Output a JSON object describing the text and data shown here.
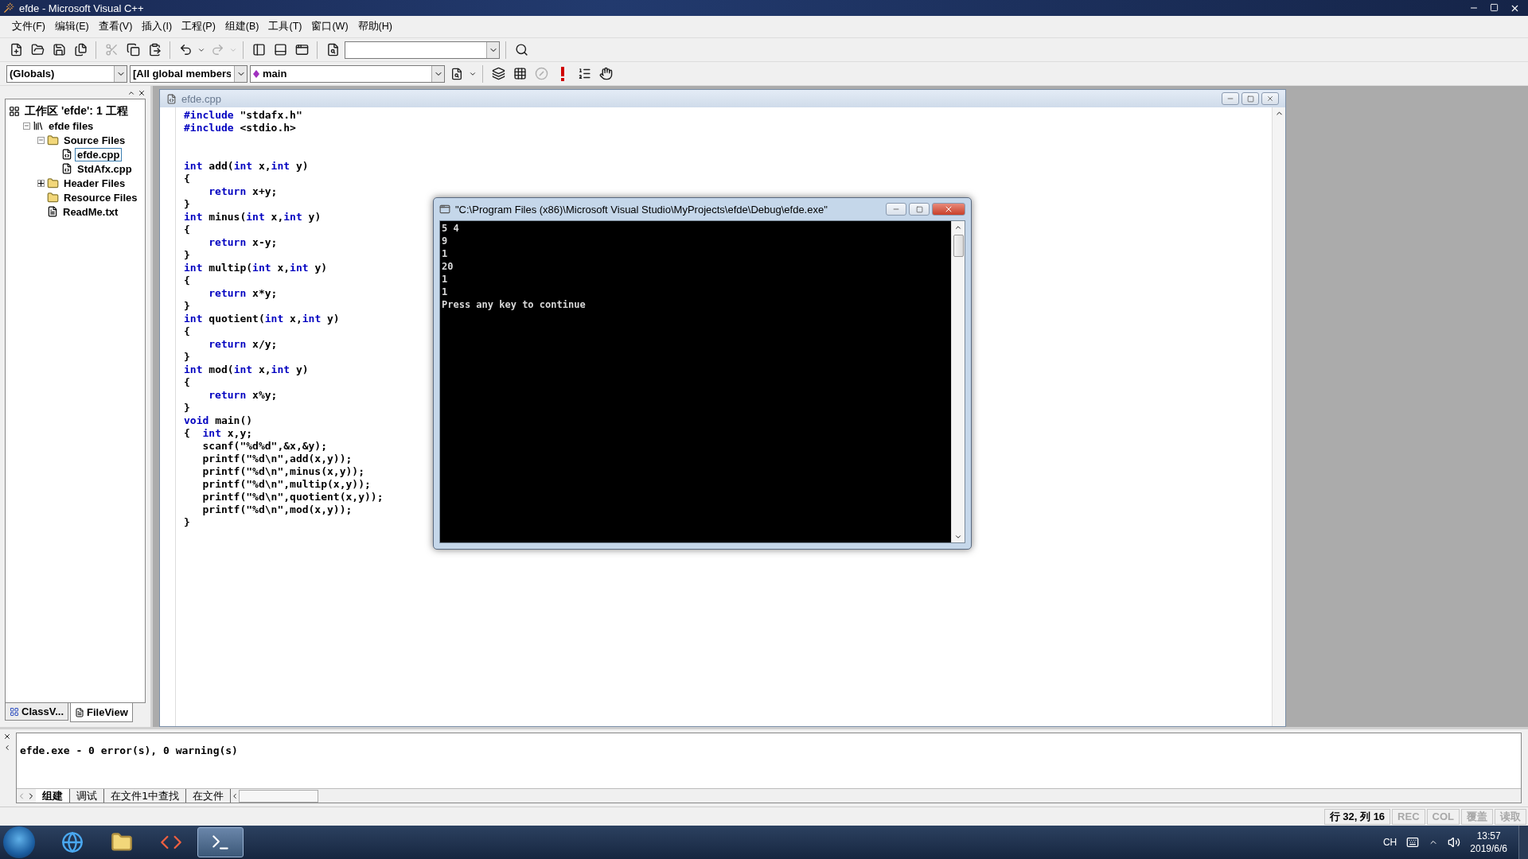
{
  "window": {
    "title": "efde - Microsoft Visual C++"
  },
  "menu": [
    "文件(F)",
    "编辑(E)",
    "查看(V)",
    "插入(I)",
    "工程(P)",
    "组建(B)",
    "工具(T)",
    "窗口(W)",
    "帮助(H)"
  ],
  "toolbar": [
    {
      "kind": "new",
      "disabled": false
    },
    {
      "kind": "open",
      "disabled": false
    },
    {
      "kind": "save",
      "disabled": false
    },
    {
      "kind": "save_all",
      "disabled": false
    },
    {
      "kind": "sep"
    },
    {
      "kind": "cut",
      "disabled": true
    },
    {
      "kind": "copy",
      "disabled": false
    },
    {
      "kind": "paste",
      "disabled": false
    },
    {
      "kind": "sep"
    },
    {
      "kind": "undo",
      "disabled": false
    },
    {
      "kind": "redo",
      "disabled": true
    },
    {
      "kind": "sep"
    },
    {
      "kind": "workspace",
      "disabled": false
    },
    {
      "kind": "output",
      "disabled": false
    },
    {
      "kind": "windows",
      "disabled": false
    },
    {
      "kind": "sep"
    },
    {
      "kind": "find_in_files",
      "disabled": false
    },
    {
      "kind": "combo"
    },
    {
      "kind": "sep"
    },
    {
      "kind": "find",
      "disabled": false
    }
  ],
  "context_bar": {
    "scope": "(Globals)",
    "members": "[All global members",
    "function": "main"
  },
  "build_bar": [
    {
      "kind": "compile",
      "disabled": false
    },
    {
      "kind": "build",
      "disabled": false
    },
    {
      "kind": "stop",
      "disabled": true
    },
    {
      "kind": "run",
      "disabled": false
    },
    {
      "kind": "goto",
      "disabled": false
    },
    {
      "kind": "breakpoint",
      "disabled": false
    }
  ],
  "workspace": {
    "tree": [
      {
        "kind": "workspace",
        "label": "工作区 'efde': 1 工程",
        "selected": false,
        "children": [
          {
            "kind": "project",
            "label": "efde files",
            "selected": false,
            "expanded": true,
            "children": [
              {
                "kind": "folder",
                "label": "Source Files",
                "selected": false,
                "expanded": true,
                "children": [
                  {
                    "kind": "source",
                    "label": "efde.cpp",
                    "selected": true
                  },
                  {
                    "kind": "source",
                    "label": "StdAfx.cpp",
                    "selected": false
                  }
                ]
              },
              {
                "kind": "folder",
                "label": "Header Files",
                "selected": false,
                "expanded": false
              },
              {
                "kind": "folder",
                "label": "Resource Files",
                "selected": false
              },
              {
                "kind": "text",
                "label": "ReadMe.txt",
                "selected": false
              }
            ]
          }
        ]
      }
    ],
    "tabs": [
      {
        "kind": "class",
        "label": "ClassV...",
        "selected": false
      },
      {
        "kind": "file",
        "label": "FileView",
        "selected": true
      }
    ]
  },
  "editor": {
    "title": "efde.cpp",
    "lines": [
      {
        "tokens": [
          {
            "kind": "keyword",
            "text": "#include"
          },
          {
            "kind": "plain",
            "text": " \"stdafx.h\""
          }
        ]
      },
      {
        "tokens": [
          {
            "kind": "keyword",
            "text": "#include"
          },
          {
            "kind": "plain",
            "text": " <stdio.h>"
          }
        ]
      },
      {
        "kind": "blank"
      },
      {
        "kind": "blank"
      },
      {
        "tokens": [
          {
            "kind": "keyword",
            "text": "int"
          },
          {
            "kind": "plain",
            "text": " add("
          },
          {
            "kind": "keyword",
            "text": "int"
          },
          {
            "kind": "plain",
            "text": " x,"
          },
          {
            "kind": "keyword",
            "text": "int"
          },
          {
            "kind": "plain",
            "text": " y)"
          }
        ]
      },
      {
        "tokens": [
          {
            "kind": "plain",
            "text": "{"
          }
        ]
      },
      {
        "tokens": [
          {
            "kind": "indent"
          },
          {
            "kind": "keyword",
            "text": "return"
          },
          {
            "kind": "plain",
            "text": " x+y;"
          }
        ]
      },
      {
        "tokens": [
          {
            "kind": "plain",
            "text": "}"
          }
        ]
      },
      {
        "tokens": [
          {
            "kind": "keyword",
            "text": "int"
          },
          {
            "kind": "plain",
            "text": " minus("
          },
          {
            "kind": "keyword",
            "text": "int"
          },
          {
            "kind": "plain",
            "text": " x,"
          },
          {
            "kind": "keyword",
            "text": "int"
          },
          {
            "kind": "plain",
            "text": " y)"
          }
        ]
      },
      {
        "tokens": [
          {
            "kind": "plain",
            "text": "{"
          }
        ]
      },
      {
        "tokens": [
          {
            "kind": "indent"
          },
          {
            "kind": "keyword",
            "text": "return"
          },
          {
            "kind": "plain",
            "text": " x-y;"
          }
        ]
      },
      {
        "tokens": [
          {
            "kind": "plain",
            "text": "}"
          }
        ]
      },
      {
        "tokens": [
          {
            "kind": "keyword",
            "text": "int"
          },
          {
            "kind": "plain",
            "text": " multip("
          },
          {
            "kind": "keyword",
            "text": "int"
          },
          {
            "kind": "plain",
            "text": " x,"
          },
          {
            "kind": "keyword",
            "text": "int"
          },
          {
            "kind": "plain",
            "text": " y)"
          }
        ]
      },
      {
        "tokens": [
          {
            "kind": "plain",
            "text": "{"
          }
        ]
      },
      {
        "tokens": [
          {
            "kind": "indent"
          },
          {
            "kind": "keyword",
            "text": "return"
          },
          {
            "kind": "plain",
            "text": " x*y;"
          }
        ]
      },
      {
        "tokens": [
          {
            "kind": "plain",
            "text": "}"
          }
        ]
      },
      {
        "tokens": [
          {
            "kind": "keyword",
            "text": "int"
          },
          {
            "kind": "plain",
            "text": " quotient("
          },
          {
            "kind": "keyword",
            "text": "int"
          },
          {
            "kind": "plain",
            "text": " x,"
          },
          {
            "kind": "keyword",
            "text": "int"
          },
          {
            "kind": "plain",
            "text": " y)"
          }
        ]
      },
      {
        "tokens": [
          {
            "kind": "plain",
            "text": "{"
          }
        ]
      },
      {
        "tokens": [
          {
            "kind": "indent"
          },
          {
            "kind": "keyword",
            "text": "return"
          },
          {
            "kind": "plain",
            "text": " x/y;"
          }
        ]
      },
      {
        "tokens": [
          {
            "kind": "plain",
            "text": "}"
          }
        ]
      },
      {
        "tokens": [
          {
            "kind": "keyword",
            "text": "int"
          },
          {
            "kind": "plain",
            "text": " mod("
          },
          {
            "kind": "keyword",
            "text": "int"
          },
          {
            "kind": "plain",
            "text": " x,"
          },
          {
            "kind": "keyword",
            "text": "int"
          },
          {
            "kind": "plain",
            "text": " y)"
          }
        ]
      },
      {
        "tokens": [
          {
            "kind": "plain",
            "text": "{"
          }
        ]
      },
      {
        "tokens": [
          {
            "kind": "indent"
          },
          {
            "kind": "keyword",
            "text": "return"
          },
          {
            "kind": "plain",
            "text": " x%y;"
          }
        ]
      },
      {
        "tokens": [
          {
            "kind": "plain",
            "text": "}"
          }
        ]
      },
      {
        "tokens": [
          {
            "kind": "keyword",
            "text": "void"
          },
          {
            "kind": "plain",
            "text": " main()"
          }
        ]
      },
      {
        "tokens": [
          {
            "kind": "plain",
            "text": "{  "
          },
          {
            "kind": "keyword",
            "text": "int"
          },
          {
            "kind": "plain",
            "text": " x,y;"
          }
        ]
      },
      {
        "tokens": [
          {
            "kind": "plain",
            "text": "   scanf(\"%d%d\",&x,&y);"
          }
        ]
      },
      {
        "tokens": [
          {
            "kind": "plain",
            "text": "   printf(\"%d\\n\",add(x,y));"
          }
        ]
      },
      {
        "tokens": [
          {
            "kind": "plain",
            "text": "   printf(\"%d\\n\",minus(x,y));"
          }
        ]
      },
      {
        "tokens": [
          {
            "kind": "plain",
            "text": "   printf(\"%d\\n\",multip(x,y));"
          }
        ]
      },
      {
        "tokens": [
          {
            "kind": "plain",
            "text": "   printf(\"%d\\n\",quotient(x,y));"
          }
        ]
      },
      {
        "tokens": [
          {
            "kind": "plain",
            "text": "   printf(\"%d\\n\",mod(x,y));"
          }
        ]
      },
      {
        "tokens": [
          {
            "kind": "plain",
            "text": "}"
          }
        ]
      }
    ]
  },
  "console": {
    "title": "\"C:\\Program Files (x86)\\Microsoft Visual Studio\\MyProjects\\efde\\Debug\\efde.exe\"",
    "lines": [
      "5 4",
      "9",
      "1",
      "20",
      "1",
      "1",
      "Press any key to continue"
    ]
  },
  "output": {
    "lines": [
      "efde.exe - 0 error(s), 0 warning(s)"
    ],
    "tabs": [
      {
        "label": "组建",
        "selected": true
      },
      {
        "label": "调试",
        "selected": false
      },
      {
        "label": "在文件1中查找",
        "selected": false
      },
      {
        "label": "在文件",
        "selected": false
      }
    ]
  },
  "status_bar": {
    "position": "行 32, 列 16",
    "indicators": [
      {
        "label": "REC",
        "active": false
      },
      {
        "label": "COL",
        "active": false
      },
      {
        "label": "覆盖",
        "active": false
      },
      {
        "label": "读取",
        "active": false
      }
    ]
  },
  "taskbar": {
    "apps": [
      {
        "kind": "browser",
        "selected": false
      },
      {
        "kind": "explorer",
        "selected": false
      },
      {
        "kind": "ide",
        "selected": false
      },
      {
        "kind": "console",
        "selected": true
      }
    ],
    "language": "CH",
    "time": "13:57",
    "date": "2019/6/6"
  }
}
